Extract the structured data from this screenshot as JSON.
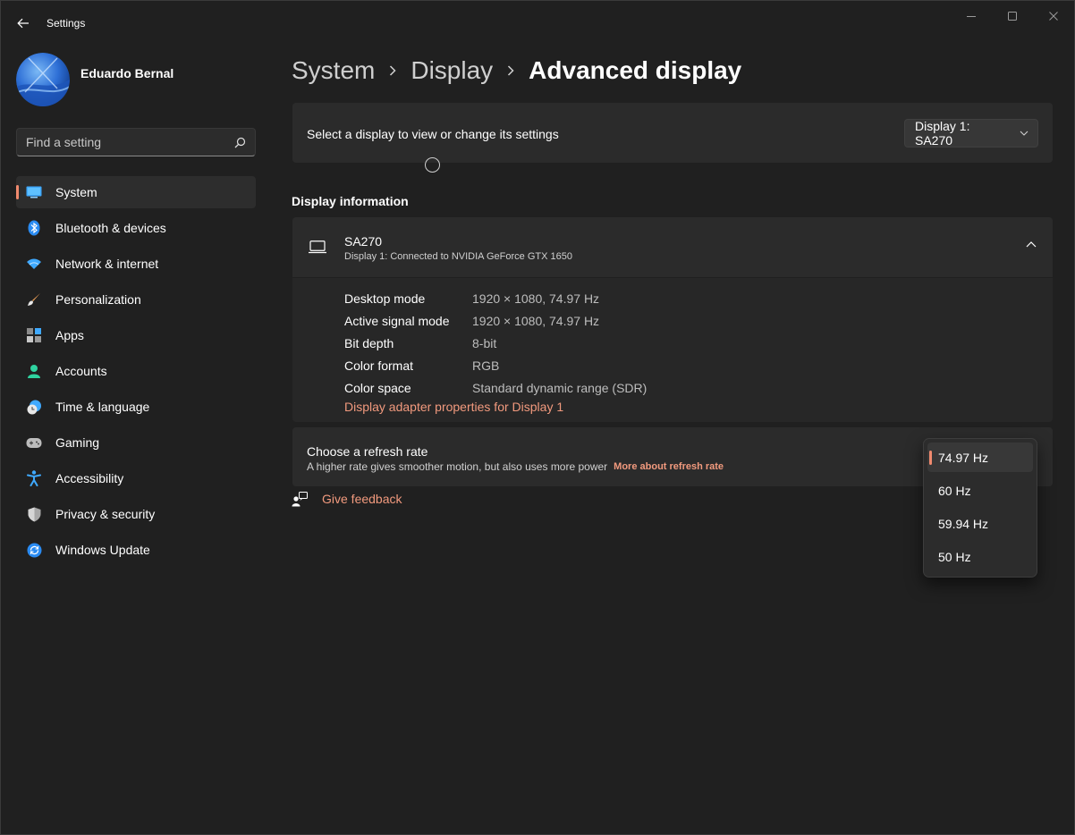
{
  "app": {
    "title": "Settings"
  },
  "profile": {
    "name": "Eduardo Bernal"
  },
  "search": {
    "placeholder": "Find a setting"
  },
  "nav": [
    {
      "label": "System",
      "icon": "system-icon",
      "selected": true
    },
    {
      "label": "Bluetooth & devices",
      "icon": "bluetooth-icon"
    },
    {
      "label": "Network & internet",
      "icon": "wifi-icon"
    },
    {
      "label": "Personalization",
      "icon": "brush-icon"
    },
    {
      "label": "Apps",
      "icon": "apps-icon"
    },
    {
      "label": "Accounts",
      "icon": "account-icon"
    },
    {
      "label": "Time & language",
      "icon": "clock-globe-icon"
    },
    {
      "label": "Gaming",
      "icon": "gamepad-icon"
    },
    {
      "label": "Accessibility",
      "icon": "accessibility-icon"
    },
    {
      "label": "Privacy & security",
      "icon": "shield-icon"
    },
    {
      "label": "Windows Update",
      "icon": "update-icon"
    }
  ],
  "breadcrumb": [
    "System",
    "Display",
    "Advanced display"
  ],
  "display_select": {
    "label": "Select a display to view or change its settings",
    "selected": "Display 1: SA270"
  },
  "display_info": {
    "section_title": "Display information",
    "name": "SA270",
    "subtitle": "Display 1: Connected to NVIDIA GeForce GTX 1650",
    "rows": [
      {
        "key": "Desktop mode",
        "value": "1920 × 1080, 74.97 Hz"
      },
      {
        "key": "Active signal mode",
        "value": "1920 × 1080, 74.97 Hz"
      },
      {
        "key": "Bit depth",
        "value": "8-bit"
      },
      {
        "key": "Color format",
        "value": "RGB"
      },
      {
        "key": "Color space",
        "value": "Standard dynamic range (SDR)"
      }
    ],
    "adapter_link": "Display adapter properties for Display 1"
  },
  "refresh_rate": {
    "title": "Choose a refresh rate",
    "subtitle": "A higher rate gives smoother motion, but also uses more power",
    "link": "More about refresh rate",
    "options": [
      "74.97 Hz",
      "60 Hz",
      "59.94 Hz",
      "50 Hz"
    ],
    "selected_index": 0
  },
  "feedback": {
    "label": "Give feedback"
  },
  "colors": {
    "accent": "#f08a6e",
    "link": "#f29a7e",
    "background": "#202020",
    "card": "#2b2b2b"
  }
}
